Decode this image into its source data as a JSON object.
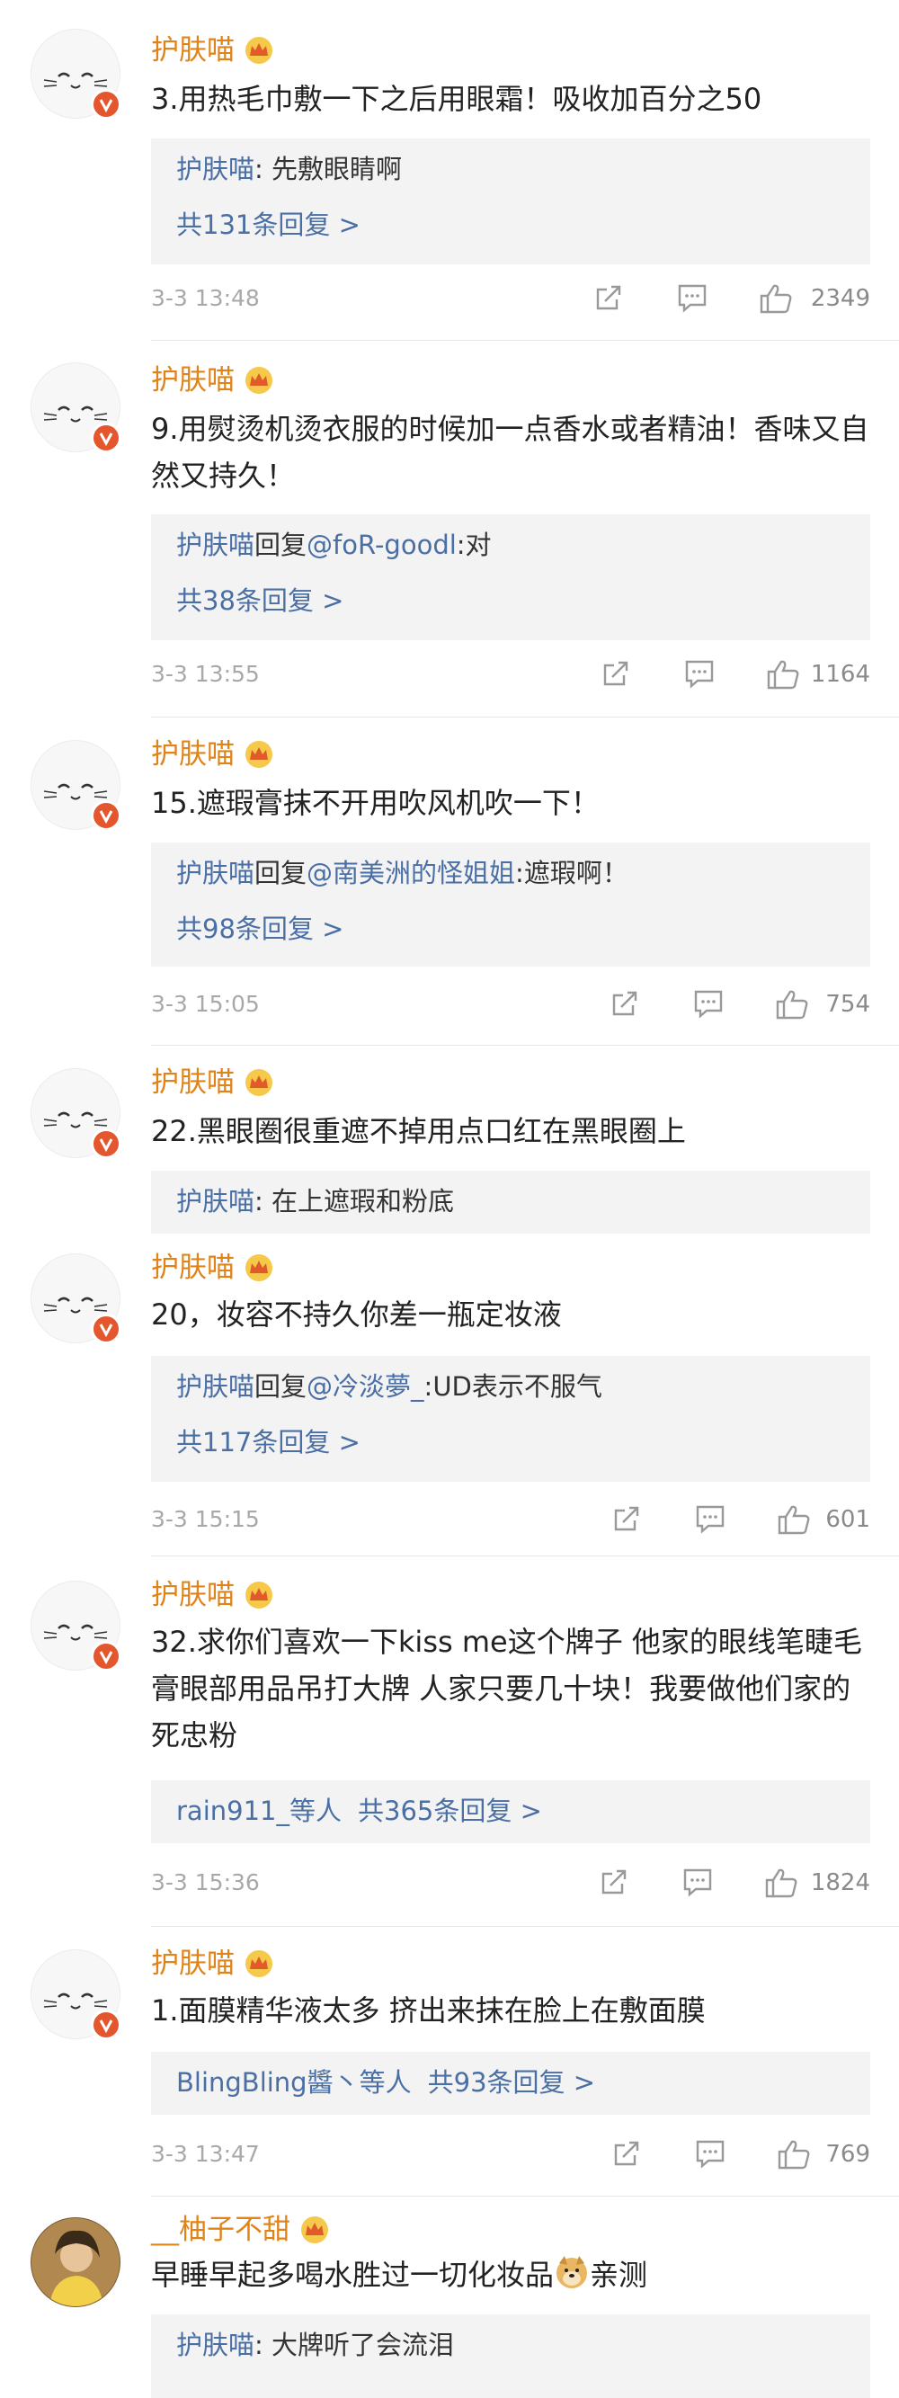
{
  "comments": [
    {
      "user": "护肤喵",
      "text": "3.用热毛巾敷一下之后用眼霜！吸收加百分之50",
      "reply_who": "护肤喵",
      "reply_text": ": 先敷眼睛啊",
      "reply_count": "共131条回复 >",
      "time": "3-3 13:48",
      "likes": "2349"
    },
    {
      "user": "护肤喵",
      "text": "9.用熨烫机烫衣服的时候加一点香水或者精油！香味又自然又持久！",
      "reply_who": "护肤喵",
      "reply_text": "回复",
      "reply_mention": "@foR-goodl",
      "reply_tail": ":对",
      "reply_count": "共38条回复 >",
      "time": "3-3 13:55",
      "likes": "1164"
    },
    {
      "user": "护肤喵",
      "text": "15.遮瑕膏抹不开用吹风机吹一下！",
      "reply_who": "护肤喵",
      "reply_text": "回复",
      "reply_mention": "@南美洲的怪姐姐",
      "reply_tail": ":遮瑕啊！",
      "reply_count": "共98条回复 >",
      "time": "3-3 15:05",
      "likes": "754"
    },
    {
      "user": "护肤喵",
      "text": "22.黑眼圈很重遮不掉用点口红在黑眼圈上",
      "reply_who": "护肤喵",
      "reply_text": ": 在上遮瑕和粉底"
    },
    {
      "user": "护肤喵",
      "text": "20，妆容不持久你差一瓶定妆液",
      "reply_who": "护肤喵",
      "reply_text": "回复",
      "reply_mention": "@冷淡夢_",
      "reply_tail": ":UD表示不服气",
      "reply_count": "共117条回复 >",
      "time": "3-3 15:15",
      "likes": "601"
    },
    {
      "user": "护肤喵",
      "text": "32.求你们喜欢一下kiss me这个牌子 他家的眼线笔睫毛膏眼部用品吊打大牌 人家只要几十块！我要做他们家的死忠粉",
      "reply_who": "rain911_",
      "reply_text": "等人",
      "reply_count": "共365条回复 >",
      "time": "3-3 15:36",
      "likes": "1824"
    },
    {
      "user": "护肤喵",
      "text": "1.面膜精华液太多 挤出来抹在脸上在敷面膜",
      "reply_who": "BlingBling醬丶",
      "reply_text": "等人",
      "reply_count": "共93条回复 >",
      "time": "3-3 13:47",
      "likes": "769"
    },
    {
      "user": "__柚子不甜",
      "text": "早睡早起多喝水胜过一切化妆品",
      "text_tail": "亲测",
      "reply_who": "护肤喵",
      "reply_text": ": 大牌听了会流泪"
    }
  ],
  "icons": {
    "share": "share-icon",
    "comment": "comment-icon",
    "like": "thumbs-up-icon",
    "crown": "crown-badge-icon",
    "verified": "verified-v-icon",
    "emoji": "doge-emoji"
  },
  "colors": {
    "username": "#e0841a",
    "link": "#4a6fa5",
    "verified": "#e4572e",
    "reply_bg": "#f3f3f3"
  }
}
